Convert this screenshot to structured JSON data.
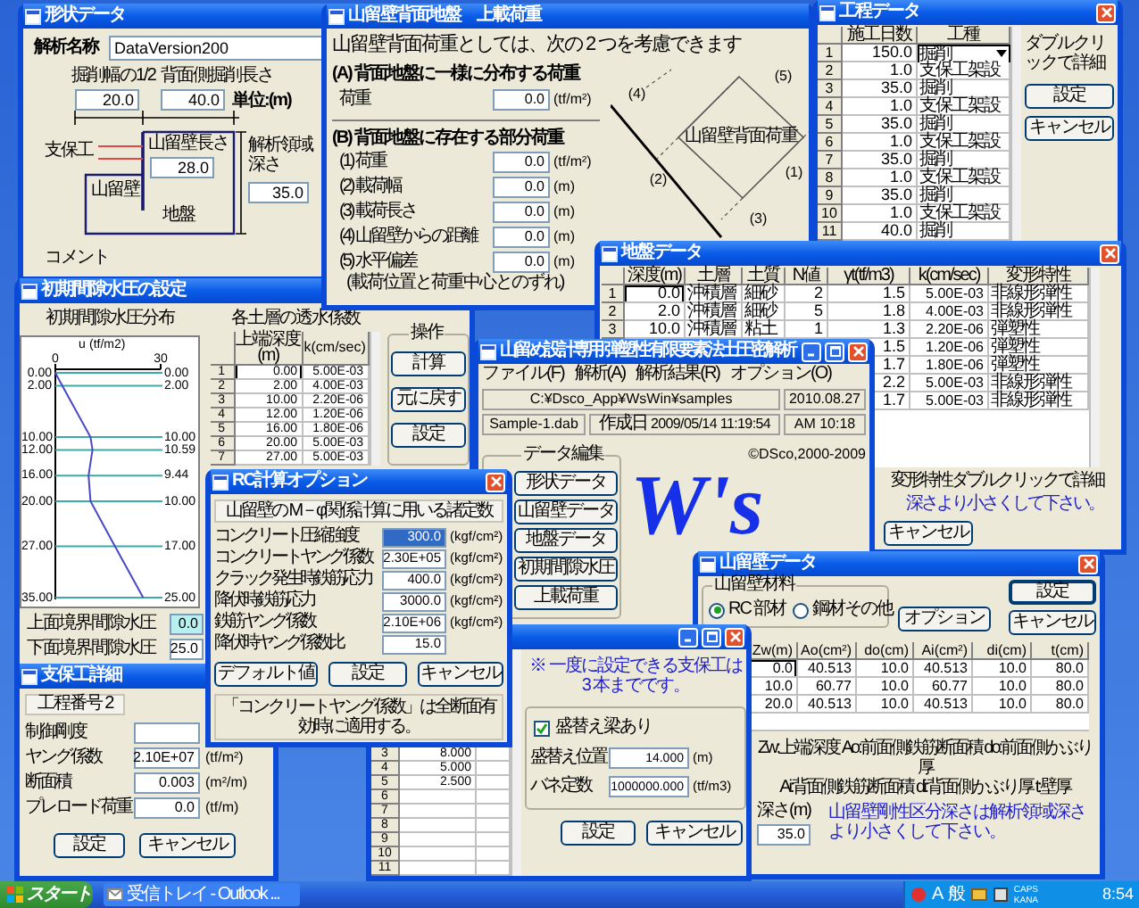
{
  "shape_data": {
    "title": "形状データ",
    "name_label": "解析名称",
    "name_value": "DataVersion200",
    "half_width": {
      "label": "掘削幅の1/2",
      "value": "20.0"
    },
    "back_length": {
      "label": "背面側掘削長さ",
      "value": "40.0"
    },
    "unit": "単位:(m)",
    "support_label": "支保工",
    "wall_length": {
      "label": "山留壁長さ",
      "value": "28.0"
    },
    "analysis_depth": {
      "label": "解析領域深さ",
      "value": "35.0"
    },
    "wall_label": "山留壁",
    "ground_label": "地盤",
    "comment_label": "コメント"
  },
  "pore_pressure": {
    "title": "初期間隙水圧の設定",
    "chart_data": {
      "type": "line",
      "title": "初期間隙水圧分布",
      "xlabel": "(tf/m2)",
      "xlim": [
        0,
        30
      ],
      "xticks": [
        0,
        30
      ],
      "x": [
        0,
        2,
        10,
        10.59,
        9.44,
        10,
        17,
        25
      ],
      "ylim": [
        35,
        0
      ],
      "yticks": [
        {
          "value": 0,
          "label": "0.00"
        },
        {
          "value": 2,
          "label": "2.00"
        },
        {
          "value": 10,
          "label": "10.00"
        },
        {
          "value": 12,
          "label": "12.00"
        },
        {
          "value": 16,
          "label": "16.00"
        },
        {
          "value": 20,
          "label": "20.00"
        },
        {
          "value": 27,
          "label": "27.00"
        },
        {
          "value": 35,
          "label": "35.00"
        }
      ],
      "series": [
        {
          "name": "u",
          "color": "#4848c8",
          "values": [
            0,
            2,
            10,
            12,
            16,
            20,
            27,
            35
          ]
        }
      ],
      "grid": true,
      "annotations": [
        "0.00",
        "2.00",
        "10.00",
        "10.59",
        "9.44",
        "10.00",
        "17.00",
        "25.00"
      ]
    },
    "table_title": "各土層の透水係数",
    "table": {
      "columns": [
        "上端深度(m)",
        "k(cm/sec)"
      ],
      "rows": [
        {
          "no": "1",
          "depth": "0.00",
          "k": "5.00E-03",
          "selected": true
        },
        {
          "no": "2",
          "depth": "2.00",
          "k": "4.00E-03",
          "selected": false
        },
        {
          "no": "3",
          "depth": "10.00",
          "k": "2.20E-06",
          "selected": false
        },
        {
          "no": "4",
          "depth": "12.00",
          "k": "1.20E-06",
          "selected": false
        },
        {
          "no": "5",
          "depth": "16.00",
          "k": "1.80E-06",
          "selected": false
        },
        {
          "no": "6",
          "depth": "20.00",
          "k": "5.00E-03",
          "selected": false
        },
        {
          "no": "7",
          "depth": "27.00",
          "k": "5.00E-03",
          "selected": false
        }
      ]
    },
    "operation_label": "操作",
    "operation_buttons": [
      "計算",
      "元に戻す",
      "設定"
    ],
    "boundaries": [
      {
        "label": "上面境界間隙水圧",
        "value": "0.0",
        "focused": true
      },
      {
        "label": "下面境界間隙水圧",
        "value": "25.0",
        "focused": false
      }
    ]
  },
  "surface_load": {
    "title": "山留壁背面地盤　上載荷重",
    "heading": "山留壁背面荷重としては、次の 2 つを考慮できます",
    "section_a": "(A) 背面地盤に一様に分布する荷重",
    "uniform": {
      "label": "荷重",
      "value": "0.0",
      "unit": "(tf/m²)"
    },
    "section_b": "(B) 背面地盤に存在する部分荷重",
    "partial": [
      {
        "label": "(1) 荷重",
        "value": "0.0",
        "unit": "(tf/m²)"
      },
      {
        "label": "(2) 載荷幅",
        "value": "0.0",
        "unit": "(m)"
      },
      {
        "label": "(3) 載荷長さ",
        "value": "0.0",
        "unit": "(m)"
      },
      {
        "label": "(4) 山留壁からの距離",
        "value": "0.0",
        "unit": "(m)"
      },
      {
        "label": "(5) 水平偏差",
        "value": "0.0",
        "unit": "(m)",
        "note": "(載荷位置と荷重中心とのずれ)"
      }
    ],
    "diagram_caption": "山留壁背面荷重",
    "diagram_labels": [
      "(4)",
      "(2)",
      "(3)",
      "(1)",
      "(5)"
    ]
  },
  "process_data": {
    "title": "工程データ",
    "columns": [
      "施工日数",
      "工種"
    ],
    "rows": [
      {
        "no": "1",
        "days": "150.0",
        "work": "掘削",
        "selected": true
      },
      {
        "no": "2",
        "days": "1.0",
        "work": "支保工架設",
        "selected": false
      },
      {
        "no": "3",
        "days": "35.0",
        "work": "掘削",
        "selected": false
      },
      {
        "no": "4",
        "days": "1.0",
        "work": "支保工架設",
        "selected": false
      },
      {
        "no": "5",
        "days": "35.0",
        "work": "掘削",
        "selected": false
      },
      {
        "no": "6",
        "days": "1.0",
        "work": "支保工架設",
        "selected": false
      },
      {
        "no": "7",
        "days": "35.0",
        "work": "掘削",
        "selected": false
      },
      {
        "no": "8",
        "days": "1.0",
        "work": "支保工架設",
        "selected": false
      },
      {
        "no": "9",
        "days": "35.0",
        "work": "掘削",
        "selected": false
      },
      {
        "no": "10",
        "days": "1.0",
        "work": "支保工架設",
        "selected": false
      },
      {
        "no": "11",
        "days": "40.0",
        "work": "掘削",
        "selected": false
      }
    ],
    "hint": "ダブルクリックで詳細",
    "buttons": [
      "設定",
      "キャンセル"
    ]
  },
  "ground_data": {
    "title": "地盤データ",
    "columns": [
      "深度(m)",
      "土層",
      "土質",
      "N値",
      "γt(tf/m3)",
      "k(cm/sec)",
      "変形特性"
    ],
    "rows": [
      {
        "no": "1",
        "depth": "0.0",
        "layer": "沖積層",
        "soil": "細砂",
        "n": "2",
        "gamma": "1.5",
        "k": "5.00E-03",
        "deform": "非線形弾性",
        "selected": true
      },
      {
        "no": "2",
        "depth": "2.0",
        "layer": "沖積層",
        "soil": "細砂",
        "n": "5",
        "gamma": "1.8",
        "k": "4.00E-03",
        "deform": "非線形弾性",
        "selected": false
      },
      {
        "no": "3",
        "depth": "10.0",
        "layer": "沖積層",
        "soil": "粘土",
        "n": "1",
        "gamma": "1.3",
        "k": "2.20E-06",
        "deform": "弾塑性",
        "selected": false
      },
      {
        "gamma": "1.5",
        "k": "1.20E-06",
        "deform": "弾塑性"
      },
      {
        "gamma": "1.7",
        "k": "1.80E-06",
        "deform": "弾塑性"
      },
      {
        "gamma": "2.2",
        "k": "5.00E-03",
        "deform": "非線形弾性"
      },
      {
        "gamma": "1.7",
        "k": "5.00E-03",
        "deform": "非線形弾性"
      }
    ],
    "hint": "変形特性ダブルクリックで詳細",
    "warning": "深さより小さくして下さい。",
    "cancel_button": "キャンセル"
  },
  "main_window": {
    "title": "山留め設計専用 弾塑性有限要素法土圧密解析",
    "menu": [
      "ファイル(F)",
      "解析(A)",
      "解析結果(R)",
      "オプション(O)"
    ],
    "path": "C:¥Dsco_App¥WsWin¥samples",
    "date": "2010.08.27",
    "file": "Sample-1.dab",
    "created_label": "作成日",
    "created": "2009/05/14 11:19:54",
    "time": "AM 10:18",
    "copyright": "©DSco,2000-2009",
    "data_edit_label": "データ編集",
    "data_edit_buttons": [
      "形状データ",
      "山留壁データ",
      "地盤データ",
      "初期間隙水圧",
      "上載荷重"
    ],
    "logo": "W's"
  },
  "wall_data": {
    "title": "山留壁データ",
    "material_label": "山留壁材料",
    "materials": [
      {
        "label": "RC 部材",
        "selected": true
      },
      {
        "label": "鋼材その他",
        "selected": false
      }
    ],
    "option_button": "オプション",
    "buttons": [
      "設定",
      "キャンセル"
    ],
    "columns": [
      "Zw(m)",
      "Ao(cm²)",
      "do(cm)",
      "Ai(cm²)",
      "di(cm)",
      "t(cm)"
    ],
    "rows": [
      {
        "cells": [
          "0.0",
          "40.513",
          "10.0",
          "40.513",
          "10.0",
          "80.0"
        ],
        "selected": true
      },
      {
        "cells": [
          "10.0",
          "60.77",
          "10.0",
          "60.77",
          "10.0",
          "80.0"
        ],
        "selected": false
      },
      {
        "cells": [
          "20.0",
          "40.513",
          "10.0",
          "40.513",
          "10.0",
          "80.0"
        ],
        "selected": false
      }
    ],
    "notes": [
      "Zw:上端深度 Ao:前面側鉄筋断面積 do:前面側かぶり厚",
      "Ai:背面側鉄筋断面積 di:背面側かぶり厚 t:壁厚"
    ],
    "depth_label": "深さ(m)",
    "depth_value": "35.0",
    "warning": "山留壁剛性区分深さは解析領域深さより小さくして下さい。"
  },
  "support_window": {
    "rows": [
      {
        "no": "3",
        "value": "8.000"
      },
      {
        "no": "4",
        "value": "5.000"
      },
      {
        "no": "5",
        "value": "2.500"
      },
      {
        "no": "6"
      },
      {
        "no": "7"
      },
      {
        "no": "8"
      },
      {
        "no": "9"
      },
      {
        "no": "10"
      },
      {
        "no": "11"
      }
    ],
    "note": "※ 一度に設定できる支保工は 3 本までです。",
    "replace_beam": {
      "label": "盛替え梁あり",
      "checked": true
    },
    "fields": [
      {
        "label": "盛替え位置",
        "value": "14.000",
        "unit": "(m)"
      },
      {
        "label": "バネ定数",
        "value": "1000000.000",
        "unit": "(tf/m3)"
      }
    ],
    "buttons": [
      "設定",
      "キャンセル"
    ]
  },
  "support_detail": {
    "title": "支保工詳細",
    "stage": "工程番号 2",
    "rows": [
      {
        "label": "制御剛度"
      },
      {
        "label": "ヤング係数",
        "value": "2.10E+07",
        "unit": "(tf/m²)"
      },
      {
        "label": "断面積",
        "value": "0.003",
        "unit": "(m²/m)"
      },
      {
        "label": "プレロード荷重",
        "value": "0.0",
        "unit": "(tf/m)"
      }
    ],
    "buttons": [
      "設定",
      "キャンセル"
    ]
  },
  "rc_options": {
    "title": "RC計算オプション",
    "header": "山留壁の M－φ関係計算に用いる諸定数",
    "rows": [
      {
        "label": "コンクリート圧縮強度",
        "value": "300.0",
        "unit": "(kgf/cm²)",
        "selected": true
      },
      {
        "label": "コンクリートヤング係数",
        "value": "2.30E+05",
        "unit": "(kgf/cm²)",
        "selected": false
      },
      {
        "label": "クラック発生時鉄筋応力",
        "value": "400.0",
        "unit": "(kgf/cm²)",
        "selected": false
      },
      {
        "label": "降伏時鉄筋応力",
        "value": "3000.0",
        "unit": "(kgf/cm²)",
        "selected": false
      },
      {
        "label": "鉄筋ヤング係数",
        "value": "2.10E+06",
        "unit": "(kgf/cm²)",
        "selected": false
      },
      {
        "label": "降伏時ヤング係数比",
        "value": "15.0",
        "selected": false
      }
    ],
    "buttons": [
      "デフォルト値",
      "設定",
      "キャンセル"
    ],
    "note": "「コンクリートヤング係数」は全断面有効時に適用する。"
  },
  "taskbar": {
    "start": "スタート",
    "tasks": [
      "受信トレイ - Outlook ..."
    ],
    "ime": "A 般",
    "locks": [
      "CAPS",
      "KANA"
    ],
    "clock": "8:54"
  }
}
